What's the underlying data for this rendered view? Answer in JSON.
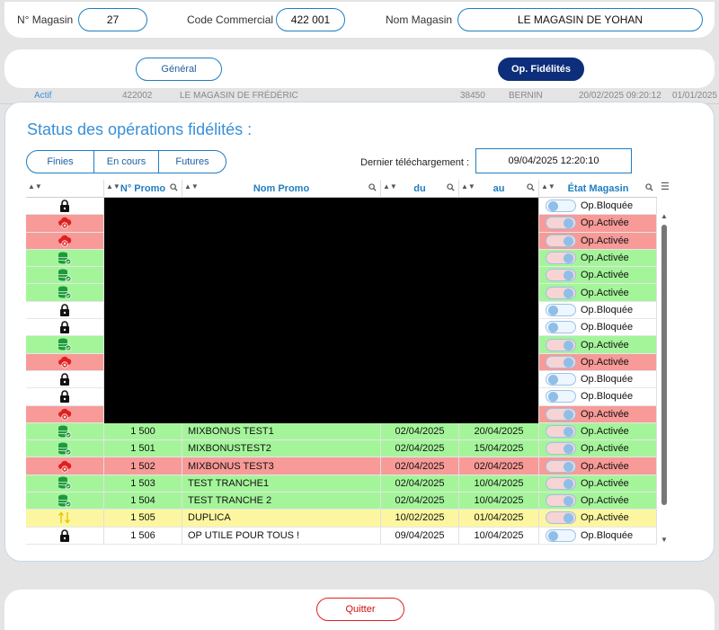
{
  "header": {
    "magasin_label": "N° Magasin",
    "magasin_value": "27",
    "code_label": "Code Commercial",
    "code_value": "422 001",
    "nom_label": "Nom Magasin",
    "nom_value": "LE MAGASIN DE YOHAN"
  },
  "background": {
    "row_actif": "Actif",
    "row_code": "422002",
    "row_name": "LE MAGASIN DE FRÉDÉRIC",
    "row_cp": "38450",
    "row_city": "BERNIN",
    "row_date": "20/02/2025 09:20:12",
    "row_date2": "01/01/2025"
  },
  "tabs": {
    "general": "Général",
    "fidelites": "Op. Fidélités"
  },
  "main": {
    "title": "Status des opérations fidélités :",
    "seg": [
      "Finies",
      "En cours",
      "Futures"
    ],
    "download_label": "Dernier téléchargement :",
    "download_value": "09/04/2025 12:20:10"
  },
  "grid": {
    "columns": [
      "",
      "N° Promo",
      "Nom Promo",
      "du",
      "au",
      "État Magasin"
    ],
    "rows": [
      {
        "status": "lock",
        "color": "white",
        "num": "",
        "name": "",
        "du": "",
        "au": "",
        "etat": "Op.Bloquée",
        "toggle": "off"
      },
      {
        "status": "cloud",
        "color": "red",
        "num": "",
        "name": "",
        "du": "",
        "au": "",
        "etat": "Op.Activée",
        "toggle": "on"
      },
      {
        "status": "cloud",
        "color": "red",
        "num": "",
        "name": "",
        "du": "",
        "au": "",
        "etat": "Op.Activée",
        "toggle": "on"
      },
      {
        "status": "db",
        "color": "green",
        "num": "",
        "name": "",
        "du": "",
        "au": "",
        "etat": "Op.Activée",
        "toggle": "on"
      },
      {
        "status": "db",
        "color": "green",
        "num": "",
        "name": "",
        "du": "",
        "au": "",
        "etat": "Op.Activée",
        "toggle": "on"
      },
      {
        "status": "db",
        "color": "green",
        "num": "",
        "name": "",
        "du": "",
        "au": "",
        "etat": "Op.Activée",
        "toggle": "on"
      },
      {
        "status": "lock",
        "color": "white",
        "num": "",
        "name": "",
        "du": "",
        "au": "",
        "etat": "Op.Bloquée",
        "toggle": "off"
      },
      {
        "status": "lock",
        "color": "white",
        "num": "",
        "name": "",
        "du": "",
        "au": "",
        "etat": "Op.Bloquée",
        "toggle": "off"
      },
      {
        "status": "db",
        "color": "green",
        "num": "",
        "name": "",
        "du": "",
        "au": "",
        "etat": "Op.Activée",
        "toggle": "on"
      },
      {
        "status": "cloud",
        "color": "red",
        "num": "",
        "name": "",
        "du": "",
        "au": "",
        "etat": "Op.Activée",
        "toggle": "on"
      },
      {
        "status": "lock",
        "color": "white",
        "num": "",
        "name": "",
        "du": "",
        "au": "",
        "etat": "Op.Bloquée",
        "toggle": "off"
      },
      {
        "status": "lock",
        "color": "white",
        "num": "",
        "name": "",
        "du": "",
        "au": "",
        "etat": "Op.Bloquée",
        "toggle": "off"
      },
      {
        "status": "cloud",
        "color": "red",
        "num": "",
        "name": "",
        "du": "",
        "au": "",
        "etat": "Op.Activée",
        "toggle": "on"
      },
      {
        "status": "db",
        "color": "green",
        "num": "1 500",
        "name": "MIXBONUS TEST1",
        "du": "02/04/2025",
        "au": "20/04/2025",
        "etat": "Op.Activée",
        "toggle": "on"
      },
      {
        "status": "db",
        "color": "green",
        "num": "1 501",
        "name": "MIXBONUSTEST2",
        "du": "02/04/2025",
        "au": "15/04/2025",
        "etat": "Op.Activée",
        "toggle": "on"
      },
      {
        "status": "cloud",
        "color": "red",
        "num": "1 502",
        "name": "MIXBONUS TEST3",
        "du": "02/04/2025",
        "au": "02/04/2025",
        "etat": "Op.Activée",
        "toggle": "on"
      },
      {
        "status": "db",
        "color": "green",
        "num": "1 503",
        "name": "TEST TRANCHE1",
        "du": "02/04/2025",
        "au": "10/04/2025",
        "etat": "Op.Activée",
        "toggle": "on"
      },
      {
        "status": "db",
        "color": "green",
        "num": "1 504",
        "name": "TEST TRANCHE 2",
        "du": "02/04/2025",
        "au": "10/04/2025",
        "etat": "Op.Activée",
        "toggle": "on"
      },
      {
        "status": "arrows",
        "color": "yellow",
        "num": "1 505",
        "name": "DUPLICA",
        "du": "10/02/2025",
        "au": "01/04/2025",
        "etat": "Op.Activée",
        "toggle": "on"
      },
      {
        "status": "lock",
        "color": "white",
        "num": "1 506",
        "name": "OP UTILE POUR TOUS !",
        "du": "09/04/2025",
        "au": "10/04/2025",
        "etat": "Op.Bloquée",
        "toggle": "off"
      }
    ]
  },
  "footer": {
    "quit": "Quitter"
  },
  "colors": {
    "accent": "#1f7ec0",
    "green_row": "#a4f59a",
    "red_row": "#f79a98",
    "yellow_row": "#fdf6a0",
    "quit": "#e02020"
  }
}
